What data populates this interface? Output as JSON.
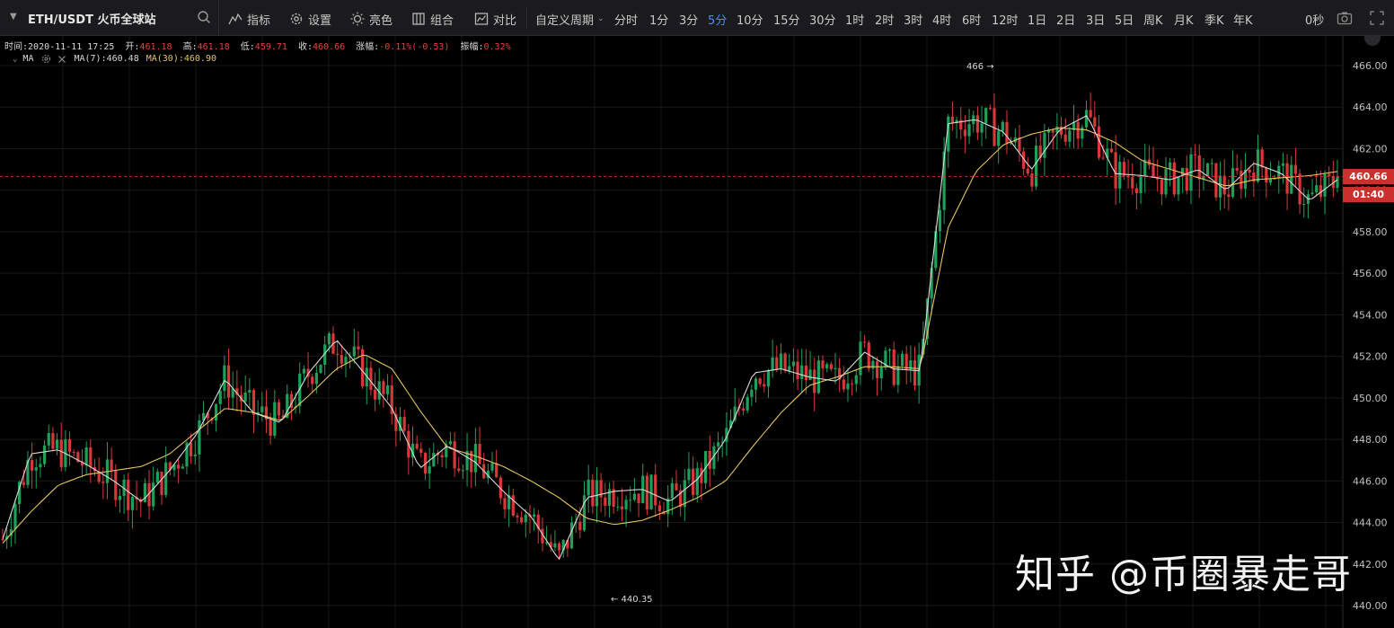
{
  "toolbar": {
    "symbol": "ETH/USDT 火币全球站",
    "indicators_label": "指标",
    "settings_label": "设置",
    "theme_label": "亮色",
    "combo_label": "组合",
    "compare_label": "对比",
    "custom_period_label": "自定义周期",
    "periods": [
      "分时",
      "1分",
      "3分",
      "5分",
      "10分",
      "15分",
      "30分",
      "1时",
      "2时",
      "3时",
      "4时",
      "6时",
      "12时",
      "1日",
      "2日",
      "3日",
      "5日",
      "周K",
      "月K",
      "季K",
      "年K"
    ],
    "active_period": "5分",
    "countdown": "0秒",
    "icons": [
      "chevron-down-icon",
      "search-icon",
      "indicators-icon",
      "gear-icon",
      "sun-icon",
      "combo-icon",
      "compare-icon",
      "camera-icon",
      "fullscreen-icon"
    ]
  },
  "ohlc": {
    "time_label": "时间:",
    "time": "2020-11-11 17:25",
    "open_label": "开:",
    "open": "461.18",
    "high_label": "高:",
    "high": "461.18",
    "low_label": "低:",
    "low": "459.71",
    "close_label": "收:",
    "close": "460.66",
    "change_label": "涨幅:",
    "change": "-0.11%(-0.53)",
    "amp_label": "振幅:",
    "amp": "0.32%"
  },
  "ma": {
    "name": "MA",
    "ma7": "MA(7):460.48",
    "ma30": "MA(30):460.90"
  },
  "markers": {
    "high_label": "466 →",
    "low_label": "← 440.35"
  },
  "price_tag": {
    "price": "460.66",
    "countdown": "01:40"
  },
  "watermark": "知乎 @币圈暴走哥",
  "colors": {
    "up": "#1fa05a",
    "down": "#d9383a",
    "ma7": "#d8d8d8",
    "ma30": "#e3c460",
    "accent": "#4d8cf5"
  },
  "chart_data": {
    "type": "candlestick",
    "y_ticks": [
      "466.00",
      "464.00",
      "462.00",
      "460.00",
      "458.00",
      "456.00",
      "454.00",
      "452.00",
      "450.00",
      "448.00",
      "446.00",
      "444.00",
      "442.00",
      "440.00"
    ],
    "ylim": [
      440,
      466
    ],
    "series": [
      {
        "name": "MA(7)",
        "values": [
          443.2,
          447.3,
          447.5,
          446.8,
          446.0,
          445.0,
          446.5,
          448.3,
          450.9,
          449.3,
          448.8,
          451.2,
          452.8,
          451.2,
          449.5,
          446.6,
          447.7,
          446.9,
          445.5,
          444.3,
          442.2,
          445.2,
          445.5,
          445.6,
          445.0,
          446.1,
          448.0,
          451.2,
          451.4,
          451.0,
          450.8,
          452.2,
          451.4,
          451.3,
          463.2,
          463.4,
          462.8,
          461.0,
          462.9,
          463.6,
          460.8,
          460.7,
          460.5,
          461.0,
          460.0,
          461.3,
          460.8,
          459.5,
          460.5
        ]
      },
      {
        "name": "MA(30)",
        "values": [
          443.0,
          444.5,
          445.8,
          446.3,
          446.5,
          446.7,
          447.3,
          448.4,
          449.5,
          449.3,
          448.9,
          450.1,
          451.4,
          452.1,
          451.4,
          449.4,
          447.6,
          447.2,
          446.7,
          446.0,
          445.2,
          444.2,
          443.9,
          444.1,
          444.6,
          445.2,
          446.0,
          447.7,
          449.3,
          450.6,
          451.0,
          451.5,
          451.5,
          451.4,
          458.2,
          460.9,
          462.2,
          462.7,
          463.0,
          462.9,
          462.3,
          461.4,
          461.0,
          460.6,
          460.2,
          460.5,
          460.6,
          460.7,
          460.9
        ]
      }
    ],
    "annotations": {
      "max": 466,
      "min": 440.35,
      "last": 460.66
    }
  }
}
